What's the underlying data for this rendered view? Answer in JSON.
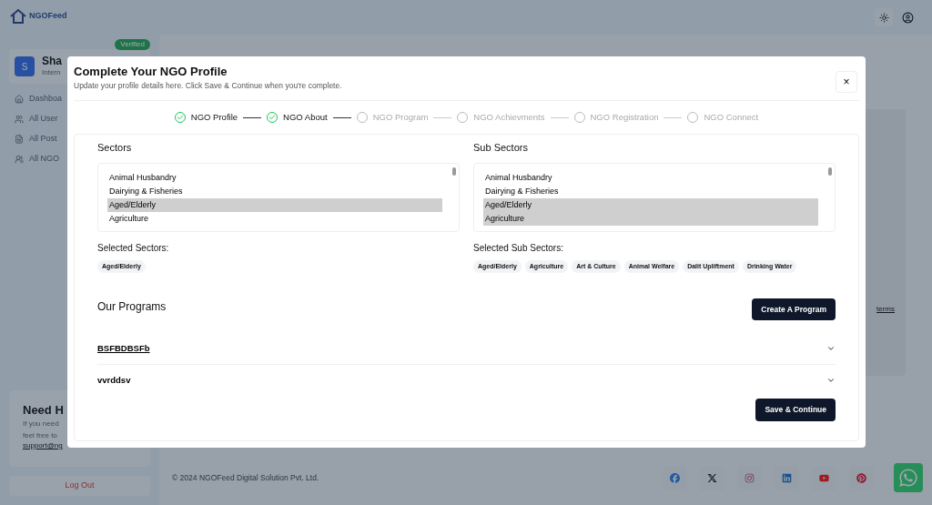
{
  "brand": {
    "logo_text": "NGOFeed"
  },
  "sidebar": {
    "badge": "Verified",
    "avatar": "S",
    "name": "Sha",
    "role": "Intern",
    "items": [
      {
        "label": "Dashboa"
      },
      {
        "label": "All User"
      },
      {
        "label": "All Post"
      },
      {
        "label": "All NGO"
      }
    ],
    "help": {
      "title": "Need H",
      "lines": [
        "If you need",
        "feel free to"
      ],
      "email": "support@ng"
    },
    "logout": "Log Out"
  },
  "page": {
    "terms_link": "terms",
    "footer": "© 2024 NGOFeed Digital Solution Pvt. Ltd."
  },
  "modal": {
    "title": "Complete Your NGO Profile",
    "subtitle": "Update your profile details here. Click Save & Continue when you're complete.",
    "close": "×",
    "steps": [
      {
        "label": "NGO Profile",
        "done": true
      },
      {
        "label": "NGO About",
        "done": true
      },
      {
        "label": "NGO Program",
        "done": false
      },
      {
        "label": "NGO Achievments",
        "done": false
      },
      {
        "label": "NGO Registration",
        "done": false
      },
      {
        "label": "NGO Connect",
        "done": false
      }
    ],
    "sectors": {
      "label": "Sectors",
      "options": [
        {
          "label": "Animal Husbandry",
          "selected": false
        },
        {
          "label": "Dairying & Fisheries",
          "selected": false
        },
        {
          "label": "Aged/Elderly",
          "selected": true
        },
        {
          "label": "Agriculture",
          "selected": false
        }
      ],
      "selected_label": "Selected Sectors:",
      "tags": [
        "Aged/Elderly"
      ]
    },
    "sub_sectors": {
      "label": "Sub Sectors",
      "options": [
        {
          "label": "Animal Husbandry",
          "selected": false
        },
        {
          "label": "Dairying & Fisheries",
          "selected": false
        },
        {
          "label": "Aged/Elderly",
          "selected": true
        },
        {
          "label": "Agriculture",
          "selected": true
        }
      ],
      "selected_label": "Selected Sub Sectors:",
      "tags": [
        "Aged/Elderly",
        "Agriculture",
        "Art & Culture",
        "Animal Welfare",
        "Dalit Upliftment",
        "Drinking Water"
      ]
    },
    "programs_title": "Our Programs",
    "create_button": "Create A Program",
    "programs": [
      {
        "title": "BSFBDBSFb",
        "expanded": false,
        "focused": true
      },
      {
        "title": "vvrddsv",
        "expanded": false,
        "focused": false
      }
    ],
    "save_button": "Save & Continue"
  }
}
